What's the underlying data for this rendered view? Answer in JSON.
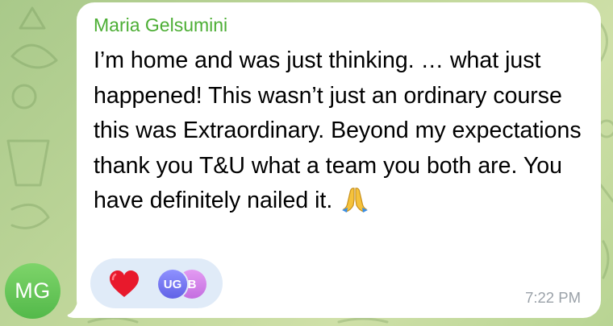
{
  "message": {
    "sender": "Maria Gelsumini",
    "text": "I’m home and was just thinking. … what just happened! This wasn’t just an ordinary course this was Extraordinary. Beyond my expectations thank you T&U what a team you both are. You have definitely nailed it. ",
    "emoji": "folded-hands",
    "time": "7:22 PM"
  },
  "avatar": {
    "initials": "MG",
    "color": "#5cbd4f"
  },
  "reactions": {
    "emoji": "red-heart",
    "reactors": [
      "UG",
      "B"
    ],
    "reactor_colors": [
      "#6f70f0",
      "#d17fe8"
    ]
  },
  "colors": {
    "sender_name": "#4cae34",
    "bubble": "#ffffff",
    "reaction_pill": "#e0ebf8",
    "timestamp": "#9aa1a8"
  }
}
